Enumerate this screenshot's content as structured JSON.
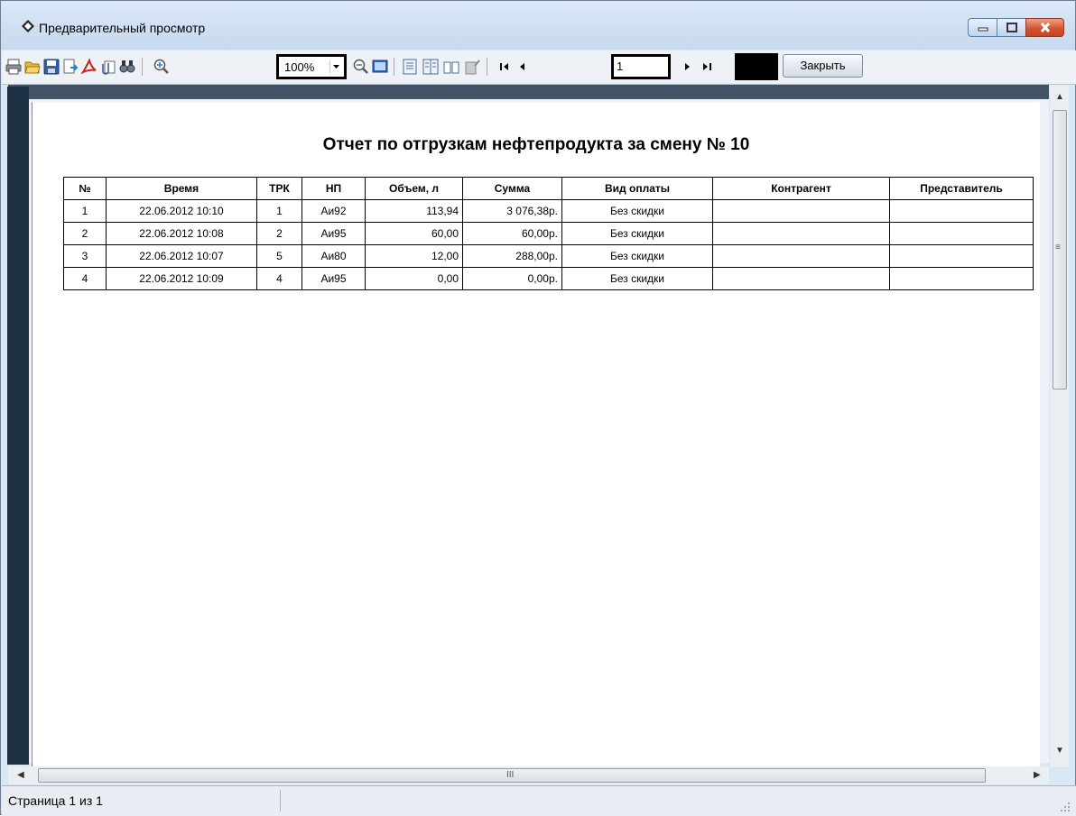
{
  "window": {
    "title": "Предварительный просмотр"
  },
  "toolbar": {
    "icons": [
      "print-icon",
      "open-folder-icon",
      "save-icon",
      "export-icon",
      "pdf-icon",
      "attach-icon",
      "find-icon",
      "zoom-in-icon",
      "zoom-out-icon",
      "full-screen-icon",
      "single-page-icon",
      "multi-page-icon",
      "book-icon",
      "edit-page-icon",
      "first-page-icon",
      "prev-page-icon",
      "next-page-icon",
      "last-page-icon"
    ],
    "zoom_value": "100%",
    "page_value": "1",
    "close_label": "Закрыть"
  },
  "report": {
    "title": "Отчет по отгрузкам нефтепродукта за смену № 10",
    "columns": [
      "№",
      "Время",
      "ТРК",
      "НП",
      "Объем, л",
      "Сумма",
      "Вид оплаты",
      "Контрагент",
      "Представитель"
    ],
    "rows": [
      [
        "1",
        "22.06.2012 10:10",
        "1",
        "Аи92",
        "113,94",
        "3 076,38р.",
        "Без скидки",
        "",
        ""
      ],
      [
        "2",
        "22.06.2012 10:08",
        "2",
        "Аи95",
        "60,00",
        "60,00р.",
        "Без скидки",
        "",
        ""
      ],
      [
        "3",
        "22.06.2012 10:07",
        "5",
        "Аи80",
        "12,00",
        "288,00р.",
        "Без скидки",
        "",
        ""
      ],
      [
        "4",
        "22.06.2012 10:09",
        "4",
        "Аи95",
        "0,00",
        "0,00р.",
        "Без скидки",
        "",
        ""
      ]
    ]
  },
  "status": {
    "page_text": "Страница 1 из 1"
  },
  "scrollbar": {
    "h_center_glyph": "III",
    "v_center_glyph": "≡"
  },
  "colors": {
    "title_bar": "#c7d9ee",
    "close_button": "#d4542f",
    "toolbar": "#eef1f6"
  }
}
